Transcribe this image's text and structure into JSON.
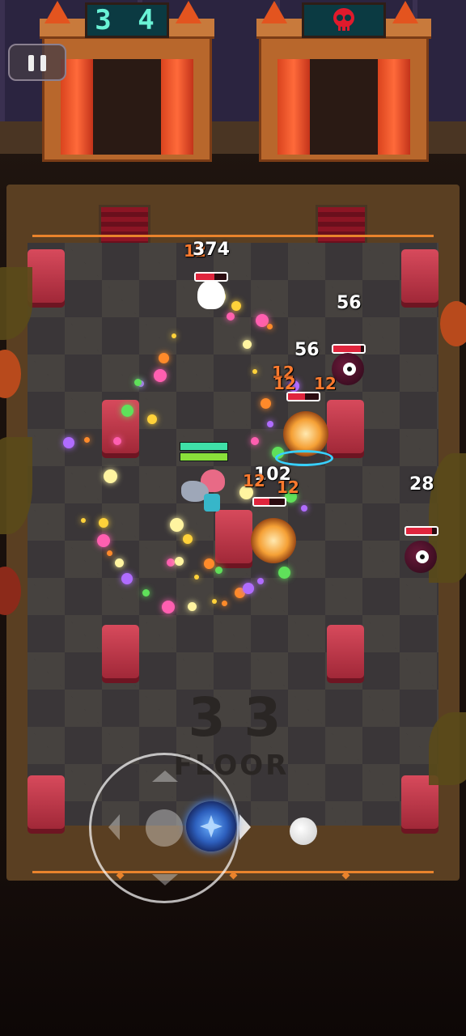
{
  "hud": {
    "left_board_score": "3 4",
    "right_board_icon": "skull-icon",
    "pause_icon": "pause-icon"
  },
  "floor": {
    "number": "3 3",
    "label": "FLOOR"
  },
  "damage_numbers": [
    {
      "text": "12",
      "kind": "crit"
    },
    {
      "text": "374",
      "kind": "normal"
    },
    {
      "text": "56",
      "kind": "normal"
    },
    {
      "text": "56",
      "kind": "normal"
    },
    {
      "text": "12",
      "kind": "crit"
    },
    {
      "text": "12",
      "kind": "crit"
    },
    {
      "text": "12",
      "kind": "crit"
    },
    {
      "text": "102",
      "kind": "normal"
    },
    {
      "text": "12",
      "kind": "crit"
    },
    {
      "text": "12",
      "kind": "crit"
    },
    {
      "text": "28",
      "kind": "normal"
    }
  ],
  "colors": {
    "accent_cyan": "#6af3d6",
    "crit_orange": "#ff7a2e",
    "hp_red": "#e0253d",
    "pillar_red": "#d74a5c"
  },
  "player": {
    "hp_fraction": 1.0
  },
  "enemies": [
    {
      "name": "ghost",
      "hp_fraction": 0.6
    },
    {
      "name": "eyeball-top",
      "hp_fraction": 0.9
    },
    {
      "name": "fire-beast-top",
      "hp_fraction": 0.55
    },
    {
      "name": "fire-beast-bottom",
      "hp_fraction": 0.5
    },
    {
      "name": "eyeball-right",
      "hp_fraction": 0.85
    }
  ],
  "controls": {
    "joystick_icon": "crosshair-icon",
    "skill_button_icon": "circle-icon"
  }
}
